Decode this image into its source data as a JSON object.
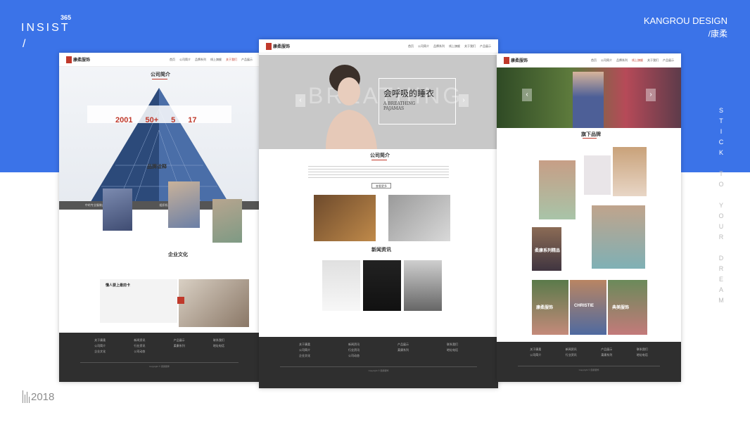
{
  "deck": {
    "left_title": "INSIST",
    "left_sup": "365",
    "left_slash": "/",
    "brand": "KANGROU DESIGN",
    "brand_sub": "/康柔",
    "vertical_letters": [
      "S",
      "T",
      "I",
      "C",
      "K",
      "",
      "T",
      "O",
      "",
      "Y",
      "O",
      "U",
      "R",
      "",
      "D",
      "R",
      "E",
      "A",
      "M"
    ],
    "year": "2018",
    "colors": {
      "accent_blue": "#3b73e8",
      "brand_red": "#c0392b",
      "footer": "#2f2f2f"
    }
  },
  "mock_left": {
    "nav": [
      "首页",
      "公司简介",
      "品牌系列",
      "线上旗舰",
      "关于我们",
      "产品展示"
    ],
    "section_title": "公司简介",
    "stats": [
      "2001",
      "50+",
      "5",
      "17"
    ],
    "bar_items": [
      "中的专业服装企业",
      "组织机构",
      "国家品牌"
    ],
    "brand_title": "品牌诠释",
    "culture_title": "企业文化",
    "quote_title": "懂人要上最前卡"
  },
  "mock_center": {
    "nav": [
      "首页",
      "公司简介",
      "品牌系列",
      "线上旗舰",
      "关于我们",
      "产品展示"
    ],
    "hero_cn": "会呼吸的睡衣",
    "hero_en_1": "A BREATHING",
    "hero_en_2": "PAJAMAS",
    "about_title": "公司简介",
    "more_label": "查看更多",
    "news_title": "新闻资讯",
    "bg_word": "BREATHING"
  },
  "mock_right": {
    "nav": [
      "首页",
      "公司简介",
      "品牌系列",
      "线上旗舰",
      "关于我们",
      "产品展示"
    ],
    "brand_title": "旗下品牌",
    "captions": [
      "柔康系列精品",
      "康柔服饰",
      "CHRISTIE",
      "典美服饰"
    ]
  }
}
